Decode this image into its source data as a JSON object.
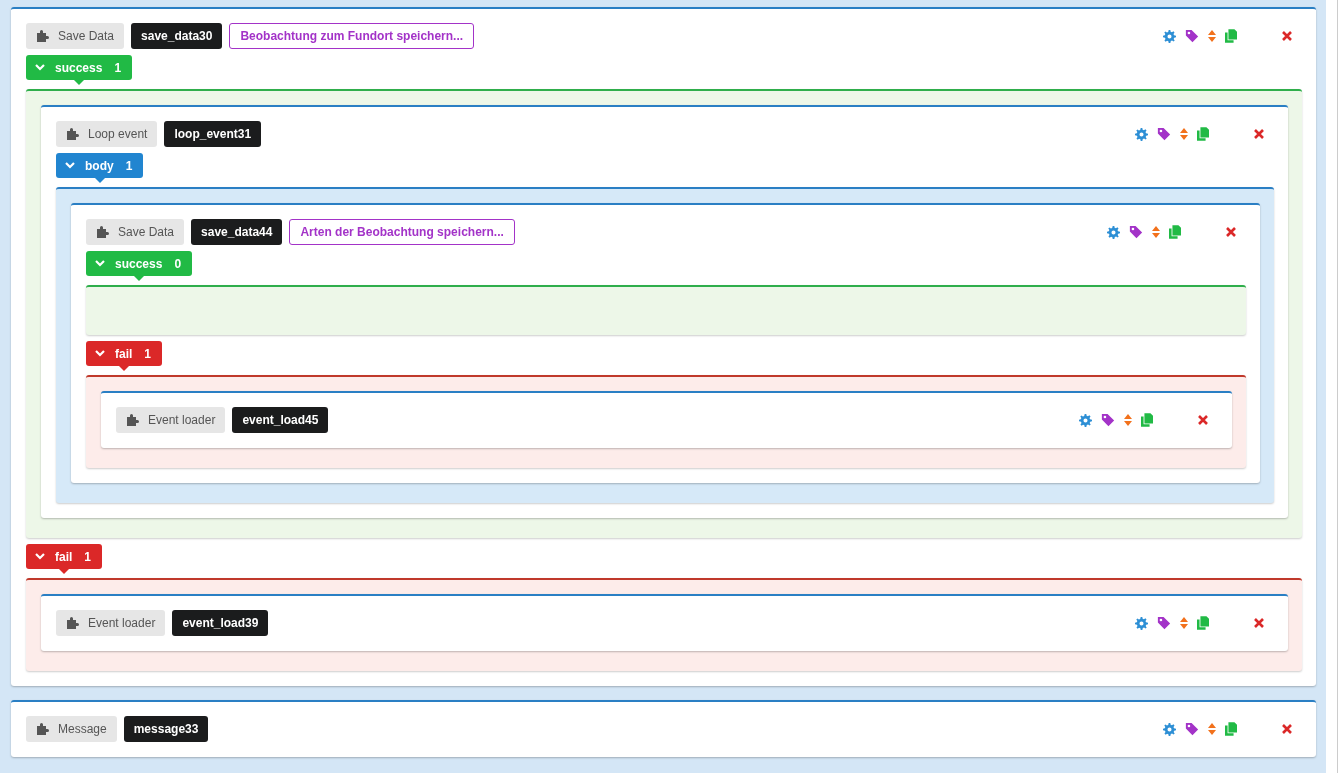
{
  "blocks": [
    {
      "type": "Save Data",
      "id": "save_data30",
      "description": "Beobachtung zum Fundort speichern...",
      "branches": [
        {
          "name": "success",
          "kind": "success",
          "count": "1",
          "expanded": true,
          "children": [
            {
              "type": "Loop event",
              "id": "loop_event31",
              "branches": [
                {
                  "name": "body",
                  "kind": "body",
                  "count": "1",
                  "expanded": true,
                  "children": [
                    {
                      "type": "Save Data",
                      "id": "save_data44",
                      "description": "Arten der Beobachtung speichern...",
                      "branches": [
                        {
                          "name": "success",
                          "kind": "success",
                          "count": "0",
                          "expanded": true
                        },
                        {
                          "name": "fail",
                          "kind": "fail",
                          "count": "1",
                          "expanded": true,
                          "children": [
                            {
                              "type": "Event loader",
                              "id": "event_load45"
                            }
                          ]
                        }
                      ]
                    }
                  ]
                }
              ]
            }
          ]
        },
        {
          "name": "fail",
          "kind": "fail",
          "count": "1",
          "expanded": true,
          "children": [
            {
              "type": "Event loader",
              "id": "event_load39"
            }
          ]
        }
      ]
    },
    {
      "type": "Message",
      "id": "message33"
    }
  ]
}
